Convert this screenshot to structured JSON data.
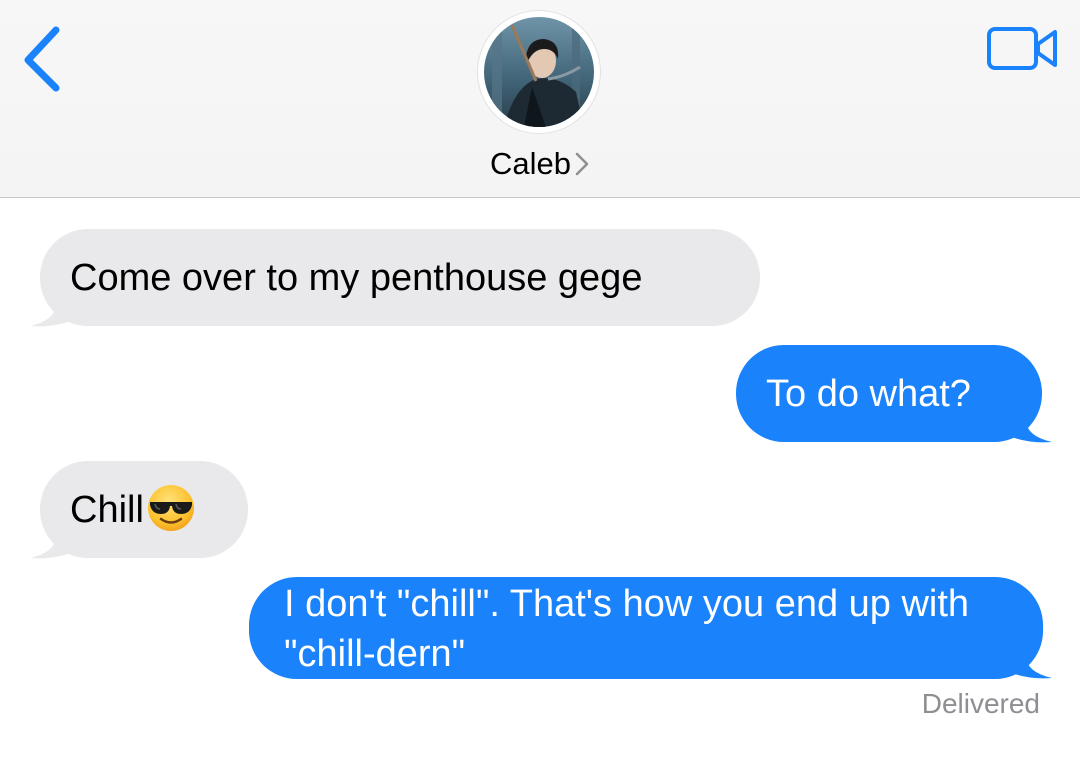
{
  "header": {
    "contact_name": "Caleb",
    "back_icon": "chevron-left-icon",
    "video_icon": "video-camera-icon",
    "accent_color": "#1a82fb"
  },
  "messages": [
    {
      "direction": "received",
      "text": "Come over to my penthouse gege"
    },
    {
      "direction": "sent",
      "text": "To do what?"
    },
    {
      "direction": "received",
      "text": "Chill",
      "emoji": "smiling-face-with-sunglasses"
    },
    {
      "direction": "sent",
      "text": "I don't \"chill\". That's how you end up with \"chill-dern\""
    }
  ],
  "status": {
    "delivered": "Delivered"
  },
  "colors": {
    "sent_bubble": "#1a82fb",
    "received_bubble": "#e9e9eb",
    "status_text": "#8e8e93"
  }
}
